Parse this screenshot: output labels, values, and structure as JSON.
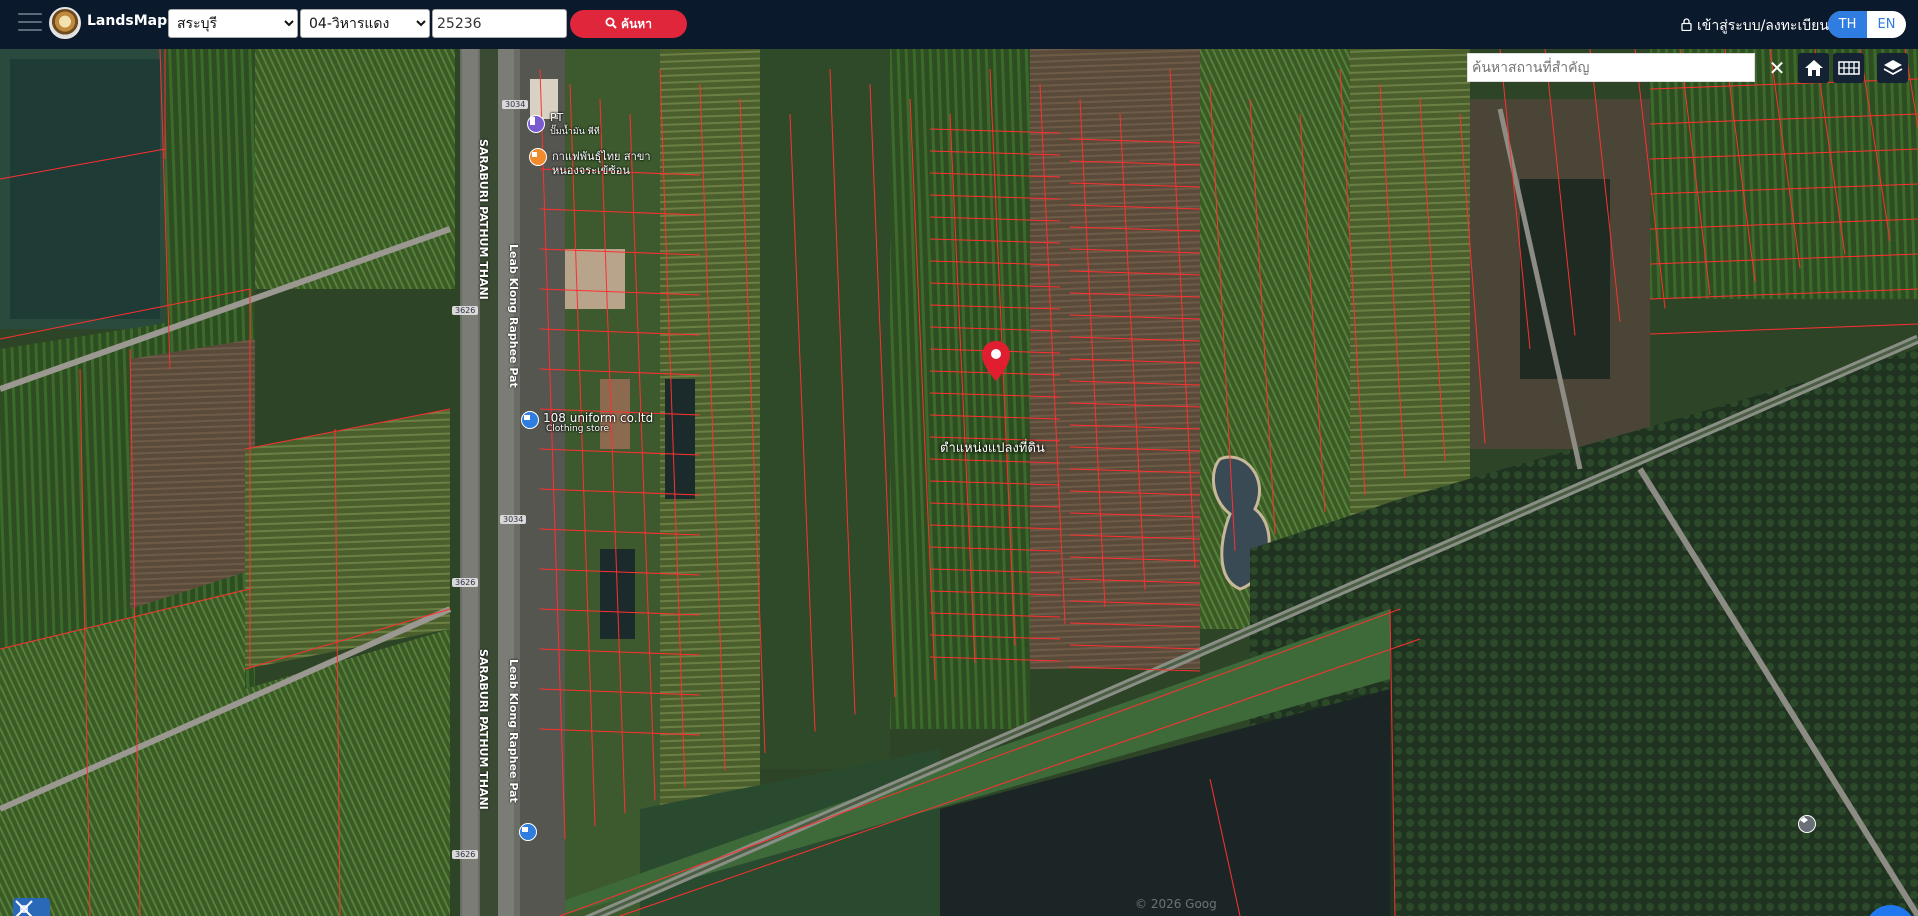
{
  "header": {
    "logo_text": "LandsMaps",
    "province": "สระบุรี",
    "district": "04-วิหารแดง",
    "parcel_code": "25236",
    "search_label": "ค้นหา",
    "login_label": "เข้าสู่ระบบ/ลงทะเบียน",
    "lang_th": "TH",
    "lang_en": "EN",
    "icons": [
      "hamburger-icon",
      "search-icon",
      "lock-icon"
    ],
    "active_lang_color": "#2f7de1",
    "search_button_color": "#e0263a"
  },
  "map": {
    "place_search_placeholder": "ค้นหาสถานที่สำคัญ",
    "close_symbol": "✕",
    "pin_label": "ตำแหน่งแปลงที่ดิน",
    "copyright": "© 2026 Goog",
    "road_names": [
      "SARABURI PATHUM THANI",
      "Leab Klong Raphee Pat",
      "Leab Klong Raphee Pat",
      "SARABURI PATHUM THANI"
    ],
    "route_shields": [
      "3034",
      "3626",
      "3034",
      "3626",
      "3626"
    ],
    "pois": [
      {
        "name": "PT",
        "sub": "ปั๊มน้ำมัน พีที",
        "icon": "gas-station-icon"
      },
      {
        "name": "กาแฟพันธุ์ไทย สาขา",
        "sub": "หนองจระเข้ซ้อน",
        "icon": "coffee-icon"
      },
      {
        "name": "108 uniform co.ltd",
        "sub": "Clothing store",
        "icon": "shopping-icon"
      }
    ],
    "tools": [
      "home-icon",
      "grid-icon",
      "layers-icon"
    ],
    "pin_color": "#e01e30",
    "parcel_line_color": "#ff3030"
  },
  "footer": {
    "left_tool_icon": "measure-tool-icon",
    "fab_symbol": "•••",
    "fab_color": "#1f78f0"
  }
}
